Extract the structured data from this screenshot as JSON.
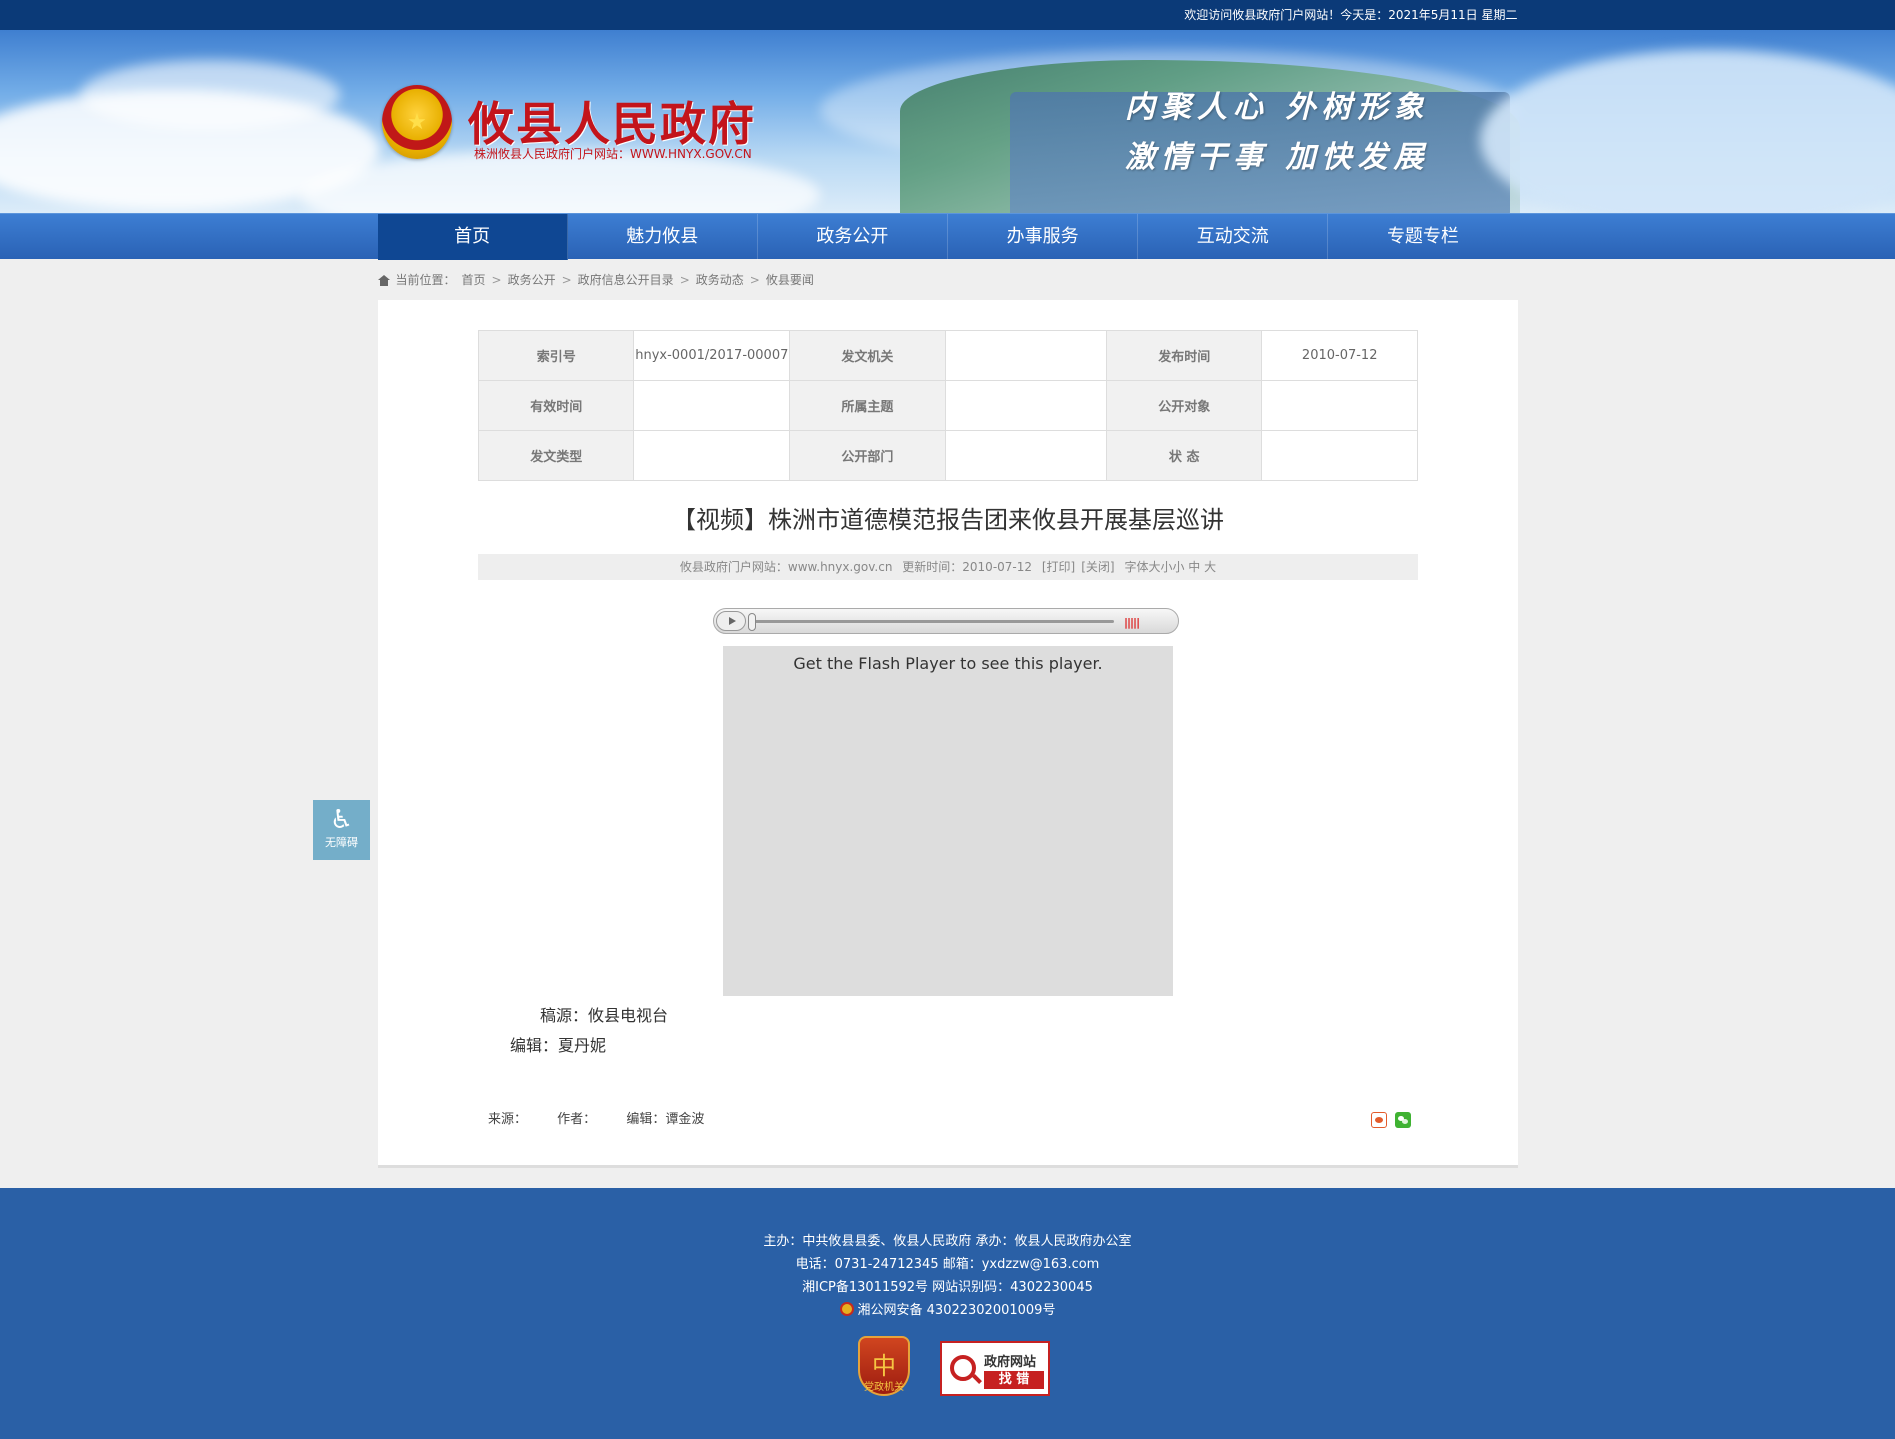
{
  "topbar": {
    "welcome": "欢迎访问攸县政府门户网站！今天是：2021年5月11日 星期二"
  },
  "header": {
    "site_title": "攸县人民政府",
    "site_subtitle": "株洲攸县人民政府门户网站：WWW.HNYX.GOV.CN",
    "slogan_line1": "内聚人心  外树形象",
    "slogan_line2": "激情干事  加快发展"
  },
  "nav": {
    "items": [
      "首页",
      "魅力攸县",
      "政务公开",
      "办事服务",
      "互动交流",
      "专题专栏"
    ],
    "active_index": 0
  },
  "breadcrumb": {
    "prefix": "当前位置：",
    "items": [
      "首页",
      "政务公开",
      "政府信息公开目录",
      "政务动态",
      "攸县要闻"
    ],
    "separator": ">"
  },
  "meta": {
    "row1": {
      "l1": "索引号",
      "v1": "hnyx-0001/2017-00007",
      "l2": "发文机关",
      "v2": "",
      "l3": "发布时间",
      "v3": "2010-07-12"
    },
    "row2": {
      "l1": "有效时间",
      "v1": "",
      "l2": "所属主题",
      "v2": "",
      "l3": "公开对象",
      "v3": ""
    },
    "row3": {
      "l1": "发文类型",
      "v1": "",
      "l2": "公开部门",
      "v2": "",
      "l3": "状 态",
      "v3": ""
    }
  },
  "article": {
    "title": "【视频】株洲市道德模范报告团来攸县开展基层巡讲",
    "info": {
      "site": "攸县政府门户网站：www.hnyx.gov.cn",
      "updated": "更新时间：2010-07-12",
      "print": "[打印]",
      "close": "[关闭]",
      "font_size": "字体大小小 中 大"
    },
    "flash_text": "Get the Flash Player to see this player.",
    "source_line": "稿源：攸县电视台",
    "editor_line": "编辑：夏丹妮",
    "foot": {
      "source": "来源：",
      "author": "作者：",
      "editor": "编辑：谭金波"
    }
  },
  "a11y": {
    "label": "无障碍",
    "icon": "wheelchair-icon"
  },
  "footer": {
    "line1": "主办：中共攸县县委、攸县人民政府 承办：攸县人民政府办公室",
    "line2": "电话：0731-24712345 邮箱：yxdzzw@163.com",
    "line3": "湘ICP备13011592号   网站识别码：4302230045",
    "line4": "湘公网安备 43022302001009号",
    "badge_party": "党政机关",
    "badge_error_1": "政府网站",
    "badge_error_2": "找 错"
  },
  "colors": {
    "nav": "#2a62b5",
    "nav_active": "#0f4793",
    "footer": "#2a60a6",
    "title_red": "#c3141b"
  }
}
